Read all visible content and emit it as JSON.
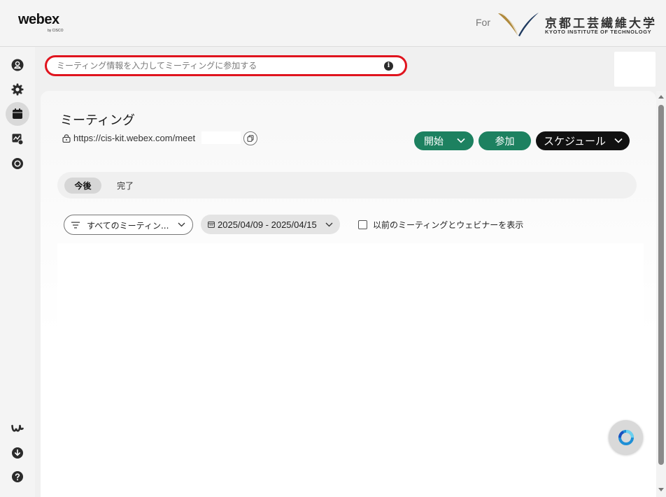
{
  "header": {
    "logo_text": "webex",
    "logo_sub": "by CISCO",
    "for_label": "For",
    "university_name": "京都工芸繊維大学",
    "university_name_en": "KYOTO INSTITUTE OF TECHNOLOGY"
  },
  "rail": {
    "items": [
      {
        "name": "profile",
        "icon": "user-icon"
      },
      {
        "name": "settings",
        "icon": "gear-icon"
      },
      {
        "name": "meetings",
        "icon": "calendar-icon",
        "active": true
      },
      {
        "name": "recordings",
        "icon": "analytics-icon"
      },
      {
        "name": "webinar",
        "icon": "circle-icon"
      }
    ],
    "bottom_items": [
      {
        "name": "webex-app",
        "icon": "webex-logo-icon"
      },
      {
        "name": "download",
        "icon": "download-icon"
      },
      {
        "name": "help",
        "icon": "help-icon"
      }
    ]
  },
  "join": {
    "placeholder": "ミーティング情報を入力してミーティングに参加する",
    "value": "",
    "info_icon_glyph": "i"
  },
  "main": {
    "title": "ミーティング",
    "personal_room_url": "https://cis-kit.webex.com/meet",
    "buttons": {
      "start": "開始",
      "join": "参加",
      "schedule": "スケジュール"
    },
    "tabs": [
      {
        "label": "今後",
        "selected": true
      },
      {
        "label": "完了",
        "selected": false
      }
    ],
    "filters": {
      "type_selected": "すべてのミーティン...",
      "date_range": "2025/04/09 - 2025/04/15",
      "show_past_label": "以前のミーティングとウェビナーを表示",
      "show_past_checked": false
    }
  },
  "colors": {
    "primary_green": "#1d8160",
    "schedule_black": "#111111",
    "highlight_red": "#e0141e",
    "university_gold": "#b08a3c",
    "university_navy": "#1f3a5f"
  }
}
